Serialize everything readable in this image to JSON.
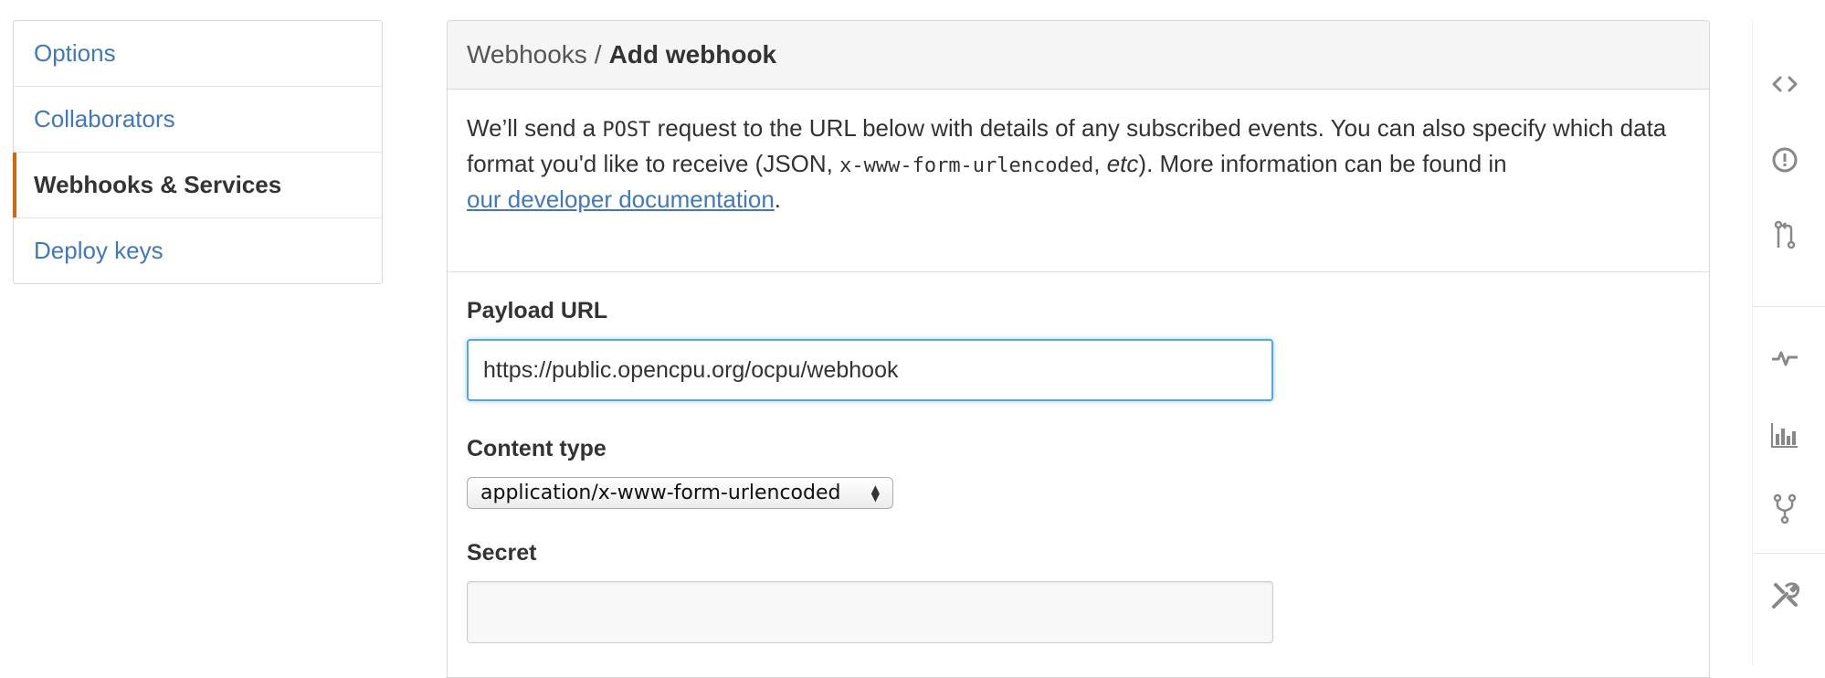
{
  "menu": {
    "items": [
      {
        "label": "Options"
      },
      {
        "label": "Collaborators"
      },
      {
        "label": "Webhooks & Services"
      },
      {
        "label": "Deploy keys"
      }
    ]
  },
  "header": {
    "parent": "Webhooks",
    "separator": "/",
    "current": "Add webhook"
  },
  "intro": {
    "part1": "We’ll send a ",
    "method": "POST",
    "part2": " request to the URL below with details of any subscribed events. You can also specify which data format you'd like to receive (JSON, ",
    "format": "x-www-form-urlencoded",
    "part3": ", ",
    "etc": "etc",
    "part4": "). More information can be found in ",
    "link": "our developer documentation",
    "part5": "."
  },
  "form": {
    "payload_label": "Payload URL",
    "payload_value": "https://public.opencpu.org/ocpu/webhook",
    "content_type_label": "Content type",
    "content_type_value": "application/x-www-form-urlencoded",
    "secret_label": "Secret",
    "secret_value": ""
  },
  "sidebar_icons": [
    "code-icon",
    "issues-icon",
    "pull-request-icon",
    "pulse-icon",
    "graphs-icon",
    "fork-icon",
    "settings-icon"
  ],
  "colors": {
    "link": "#4078c0",
    "selected_bar": "#d26911",
    "focus_border": "#51a7e8",
    "icon": "#888888"
  }
}
